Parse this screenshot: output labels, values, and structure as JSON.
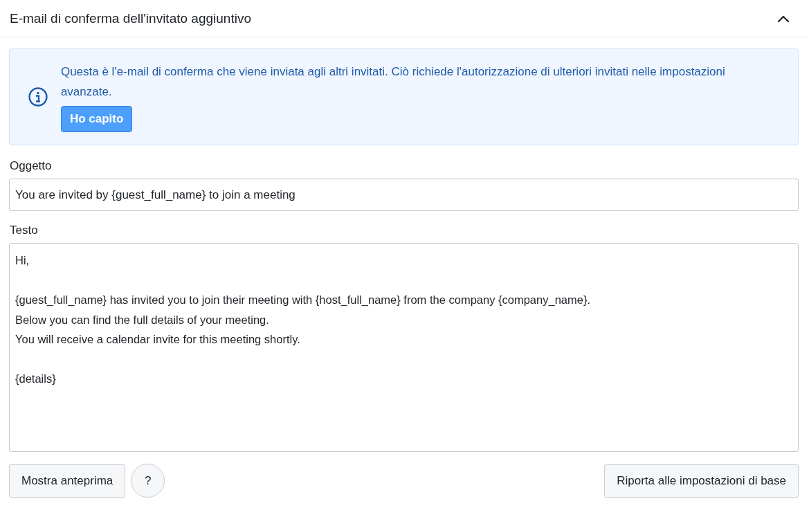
{
  "section": {
    "title": "E-mail di conferma dell'invitato aggiuntivo",
    "expanded": true
  },
  "notice": {
    "text": "Questa è l'e-mail di conferma che viene inviata agli altri invitati. Ciò richiede l'autorizzazione di ulteriori invitati nelle impostazioni avanzate.",
    "button": "Ho capito"
  },
  "subject": {
    "label": "Oggetto",
    "value": "You are invited by {guest_full_name} to join a meeting"
  },
  "body": {
    "label": "Testo",
    "value": "Hi,\n\n{guest_full_name} has invited you to join their meeting with {host_full_name} from the company {company_name}.\nBelow you can find the full details of your meeting.\nYou will receive a calendar invite for this meeting shortly.\n\n{details}"
  },
  "actions": {
    "preview": "Mostra anteprima",
    "help": "?",
    "reset": "Riporta alle impostazioni di base"
  }
}
